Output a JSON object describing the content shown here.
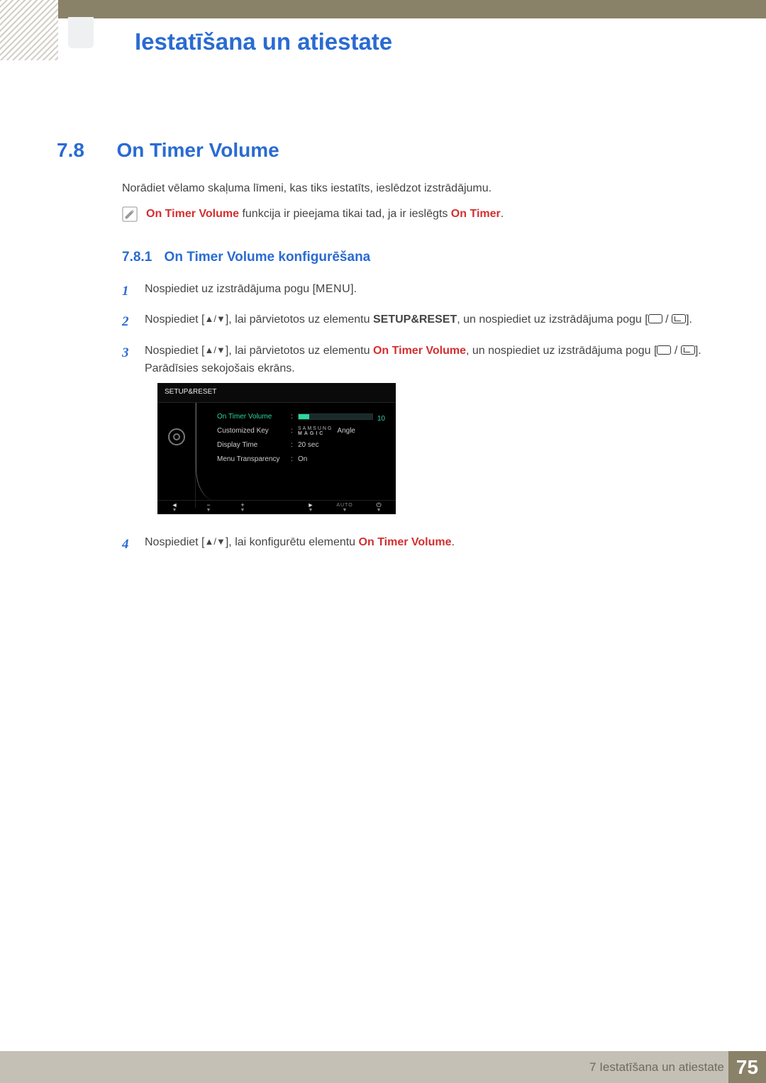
{
  "chapter_title": "Iestatīšana un atiestate",
  "section": {
    "num": "7.8",
    "title": "On Timer Volume"
  },
  "intro": "Norādiet vēlamo skaļuma līmeni, kas tiks iestatīts, ieslēdzot izstrādājumu.",
  "note": {
    "hl1": "On Timer Volume",
    "mid": " funkcija ir pieejama tikai tad, ja ir ieslēgts ",
    "hl2": "On Timer",
    "end": "."
  },
  "subsection": {
    "num": "7.8.1",
    "title": "On Timer Volume konfigurēšana"
  },
  "steps": {
    "s1": {
      "num": "1",
      "t1": "Nospiediet uz izstrādājuma pogu [",
      "menu": "MENU",
      "t2": "]."
    },
    "s2": {
      "num": "2",
      "t1": "Nospiediet [",
      "arrows": "▲/▼",
      "t2": "], lai pārvietotos uz elementu ",
      "bold": "SETUP&RESET",
      "t3": ", un nospiediet uz izstrādājuma pogu [",
      "t4": "]."
    },
    "s3": {
      "num": "3",
      "t1": "Nospiediet [",
      "arrows": "▲/▼",
      "t2": "], lai pārvietotos uz elementu ",
      "hl": "On Timer Volume",
      "t3": ", un nospiediet uz izstrādājuma pogu [",
      "t4": "]. Parādīsies sekojošais ekrāns."
    },
    "s4": {
      "num": "4",
      "t1": "Nospiediet [",
      "arrows": "▲/▼",
      "t2": "], lai konfigurētu elementu ",
      "hl": "On Timer Volume",
      "t3": "."
    }
  },
  "osd": {
    "title": "SETUP&RESET",
    "rows": {
      "r0": {
        "label": "On Timer  Volume",
        "value": "10"
      },
      "r1": {
        "label": "Customized Key",
        "magic1": "SAMSUNG",
        "magic2": "MAGIC",
        "suffix": " Angle"
      },
      "r2": {
        "label": "Display Time",
        "value": "20 sec"
      },
      "r3": {
        "label": "Menu Transparency",
        "value": "On"
      }
    },
    "footer": {
      "b0": "◄",
      "b1": "−",
      "b2": "+",
      "b3": "►",
      "b4": "AUTO",
      "b5": "⏻"
    }
  },
  "footer": {
    "chapter_label": "7 Iestatīšana un atiestate",
    "page": "75"
  }
}
